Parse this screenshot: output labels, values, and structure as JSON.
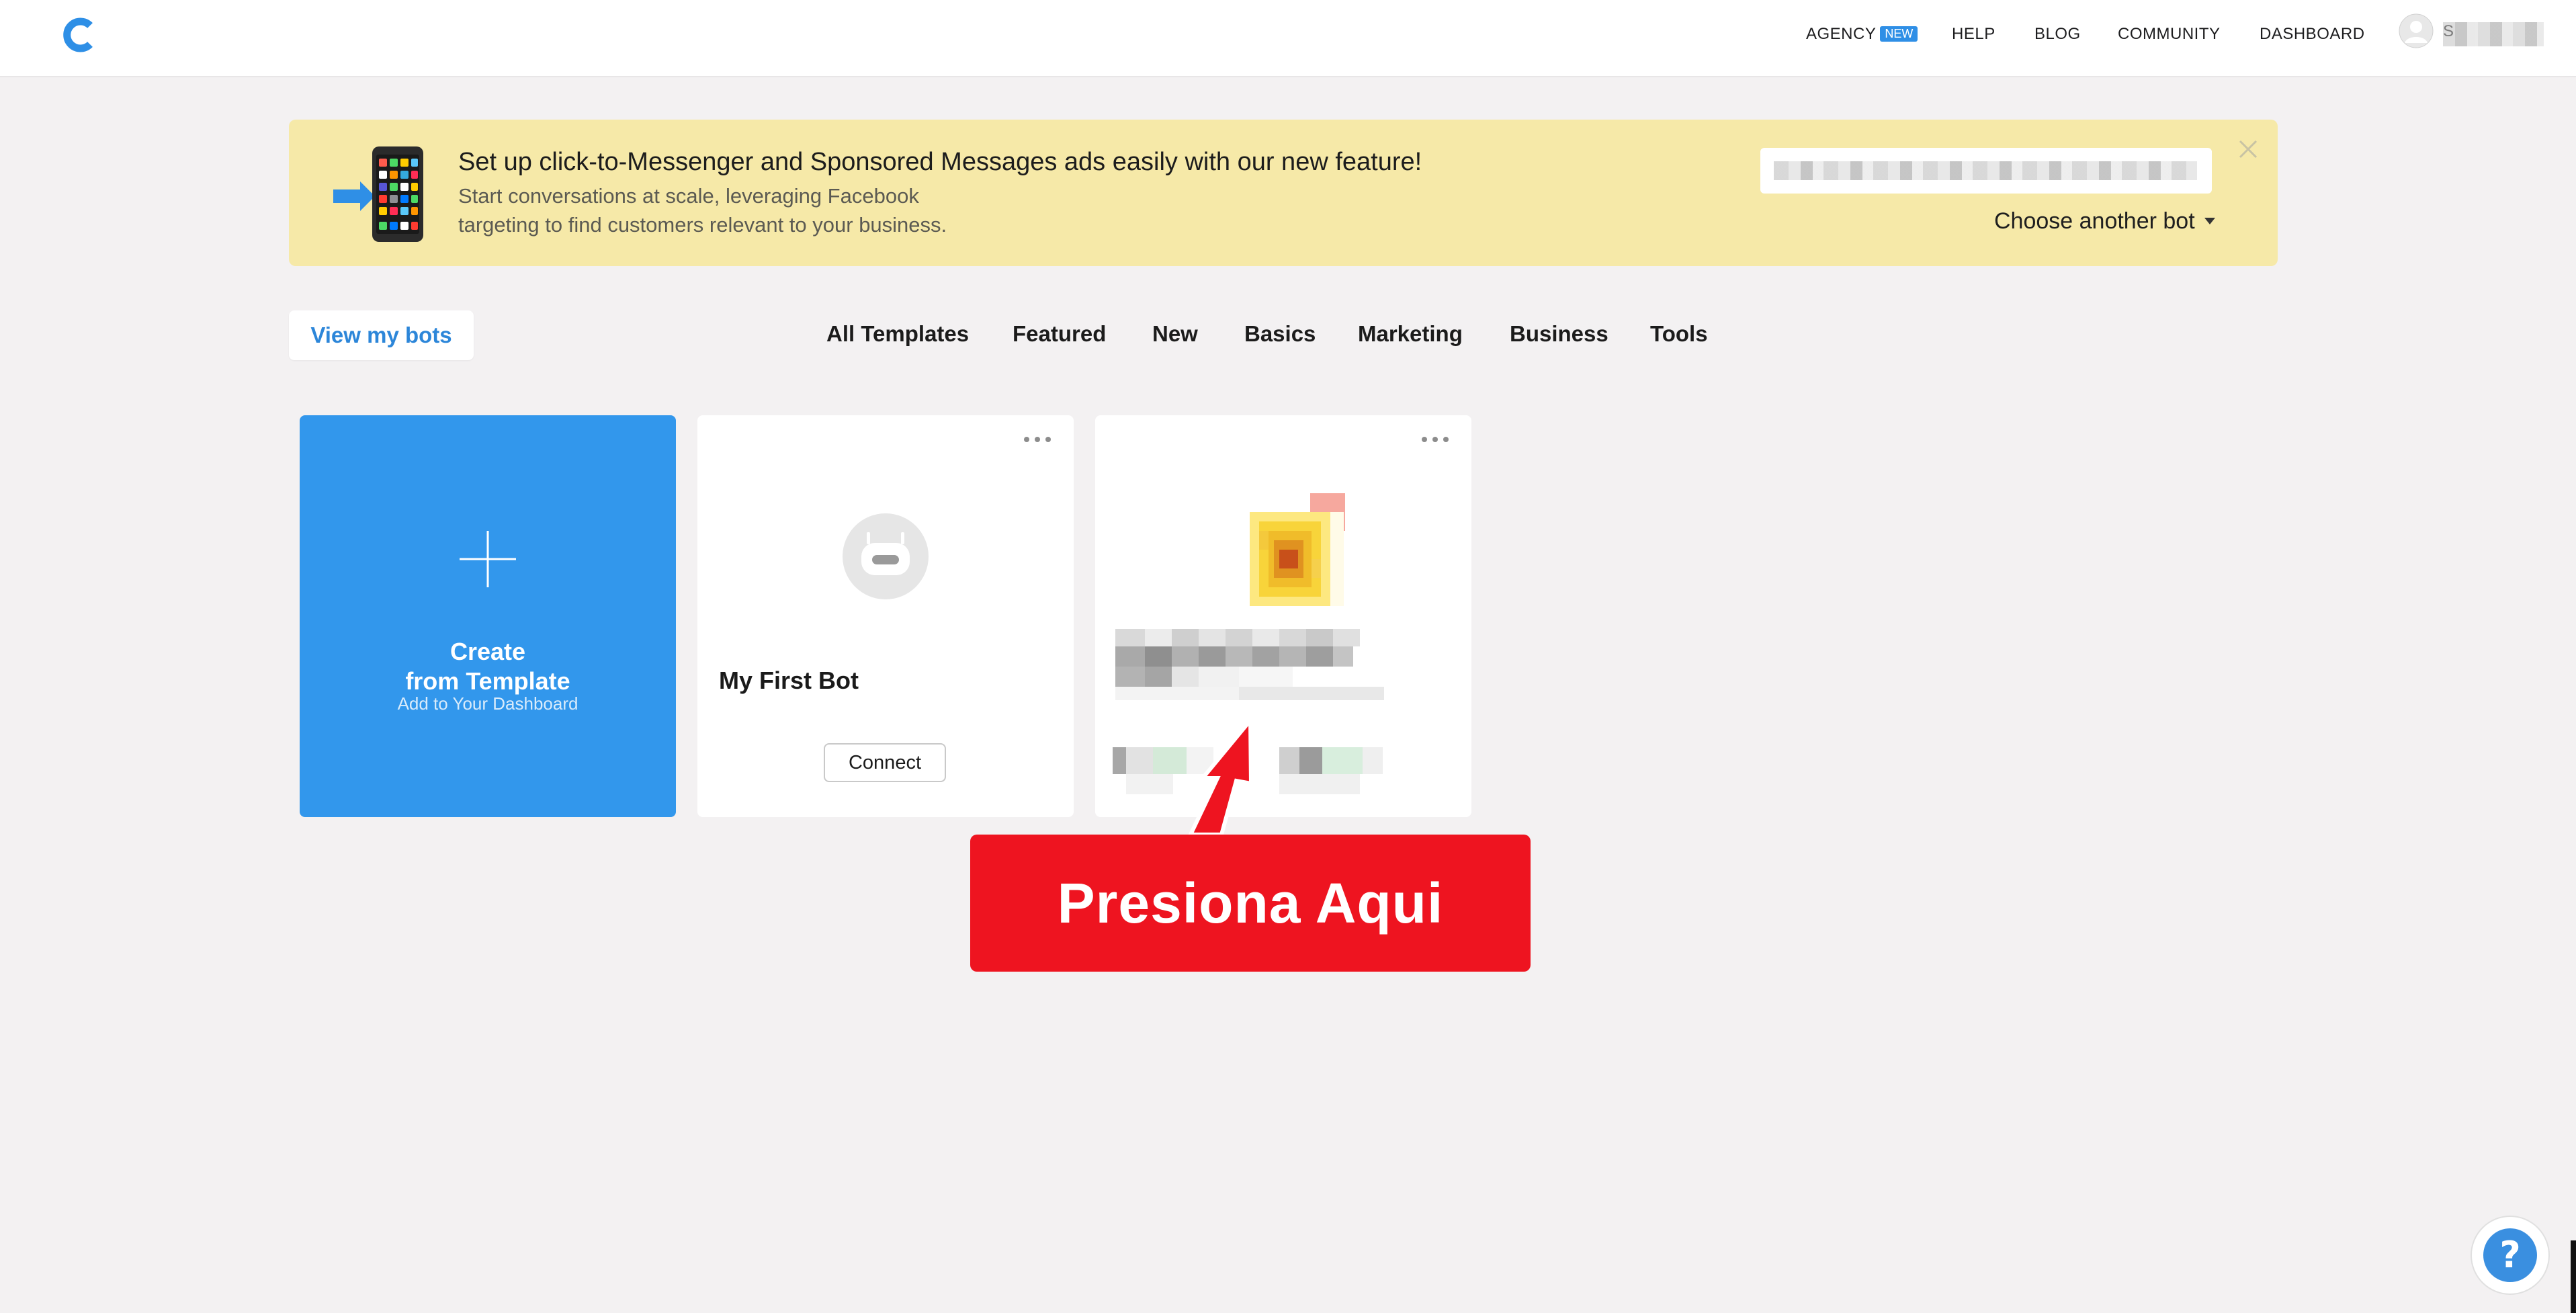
{
  "nav": {
    "items": [
      {
        "label": "AGENCY",
        "badge": "NEW"
      },
      {
        "label": "HELP"
      },
      {
        "label": "BLOG"
      },
      {
        "label": "COMMUNITY"
      },
      {
        "label": "DASHBOARD"
      }
    ],
    "user_initial": "S"
  },
  "banner": {
    "title": "Set up click-to-Messenger and Sponsored Messages ads easily with our new feature!",
    "subtitle_line1": "Start conversations at scale, leveraging Facebook",
    "subtitle_line2": "targeting to find customers relevant to your business.",
    "choose_bot": "Choose another bot"
  },
  "toolbar": {
    "view_bots": "View my bots",
    "tabs": [
      "All Templates",
      "Featured",
      "New",
      "Basics",
      "Marketing",
      "Business",
      "Tools"
    ]
  },
  "cards": {
    "create": {
      "title_line1": "Create",
      "title_line2": "from Template",
      "subtitle": "Add to Your Dashboard"
    },
    "bot1": {
      "name": "My First Bot",
      "connect": "Connect"
    }
  },
  "annotation": {
    "label": "Presiona Aqui"
  },
  "help": {
    "label": "?"
  },
  "colors": {
    "brand_blue": "#3297ec",
    "banner_bg": "#f6e9a8",
    "callout_red": "#ee1420",
    "page_bg": "#f3f1f2"
  }
}
